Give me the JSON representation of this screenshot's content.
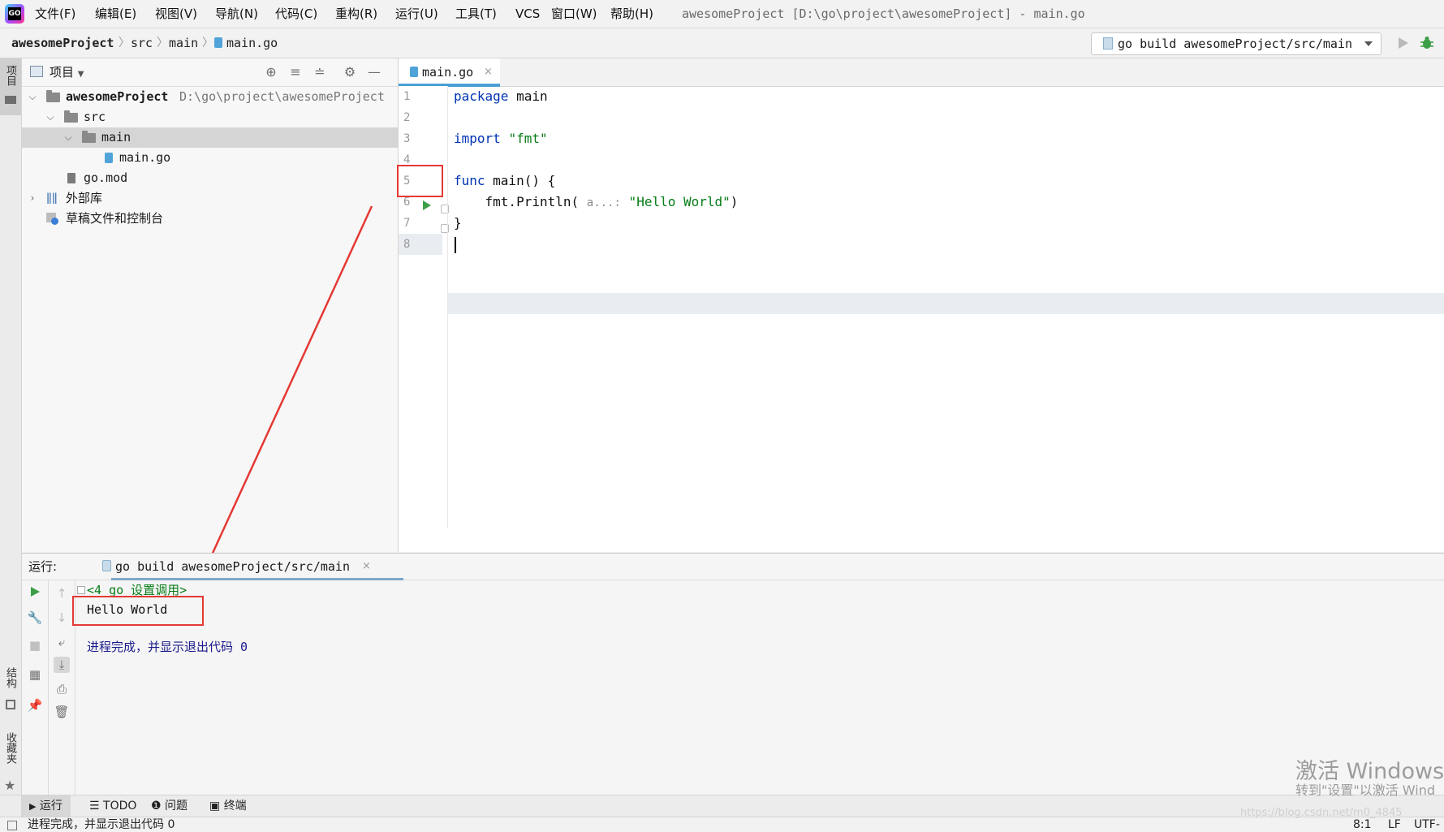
{
  "menubar": {
    "logo_text": "GO",
    "items": [
      "文件(F)",
      "编辑(E)",
      "视图(V)",
      "导航(N)",
      "代码(C)",
      "重构(R)",
      "运行(U)",
      "工具(T)",
      "VCS",
      "窗口(W)",
      "帮助(H)"
    ],
    "window_title": "awesomeProject [D:\\go\\project\\awesomeProject] - main.go"
  },
  "breadcrumb": {
    "items": [
      "awesomeProject",
      "src",
      "main",
      "main.go"
    ]
  },
  "run_config": {
    "label": "go build awesomeProject/src/main"
  },
  "left_strip": {
    "project_tab": "项目",
    "structure_tab": "结构",
    "favorites_tab": "收藏夹"
  },
  "project_panel": {
    "title": "项目",
    "tree": [
      {
        "label": "awesomeProject",
        "path": "D:\\go\\project\\awesomeProject"
      },
      {
        "label": "src"
      },
      {
        "label": "main"
      },
      {
        "label": "main.go"
      },
      {
        "label": "go.mod"
      },
      {
        "label": "外部库"
      },
      {
        "label": "草稿文件和控制台"
      }
    ]
  },
  "editor": {
    "tab_label": "main.go",
    "line_numbers": [
      "1",
      "2",
      "3",
      "4",
      "5",
      "6",
      "7",
      "8"
    ],
    "code": {
      "l1_kw": "package",
      "l1_rest": " main",
      "l3_kw": "import",
      "l3_str": "\"fmt\"",
      "l5_kw": "func",
      "l5_rest": " main() {",
      "l6_pre": "    fmt.Println( ",
      "l6_hint": "a...:",
      "l6_str": " \"Hello World\"",
      "l6_post": ")",
      "l7": "}"
    }
  },
  "run_panel": {
    "label": "运行:",
    "tab_label": "go build awesomeProject/src/main",
    "console": {
      "line1": "<4 go 设置调用>",
      "line2": "Hello World",
      "line3": "进程完成，并显示退出代码 0"
    }
  },
  "bottom_tabs": [
    "运行",
    "TODO",
    "问题",
    "终端"
  ],
  "status_bar": {
    "message": "进程完成，并显示退出代码 0",
    "position": "8:1",
    "line_sep": "LF",
    "encoding": "UTF-"
  },
  "watermark": {
    "line1": "激活 Windows",
    "line2": "转到\"设置\"以激活 Wind",
    "url": "https://blog.csdn.net/m0_4845"
  },
  "colors": {
    "keyword": "#0033b3",
    "string": "#067d17",
    "annotation_red": "#e53935",
    "run_green": "#3c9e46",
    "console_blue": "#1a1a8c"
  }
}
